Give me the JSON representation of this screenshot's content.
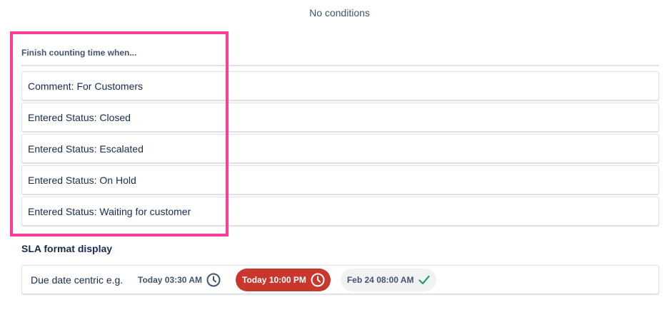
{
  "no_conditions_text": "No conditions",
  "finish": {
    "heading": "Finish counting time when...",
    "items": [
      "Comment: For Customers",
      "Entered Status: Closed",
      "Entered Status: Escalated",
      "Entered Status: On Hold",
      "Entered Status: Waiting for customer"
    ]
  },
  "highlight_color": "#ff3d94",
  "sla_format": {
    "heading": "SLA format display",
    "option_label": "Due date centric e.g.",
    "examples": [
      {
        "text": "Today 03:30 AM",
        "icon": "clock-icon",
        "style": "plain"
      },
      {
        "text": "Today 10:00 PM",
        "icon": "clock-icon",
        "style": "overdue",
        "color": "#c9372c"
      },
      {
        "text": "Feb 24 08:00 AM",
        "icon": "checkmark-icon",
        "style": "met",
        "color": "#22a06b"
      }
    ]
  }
}
